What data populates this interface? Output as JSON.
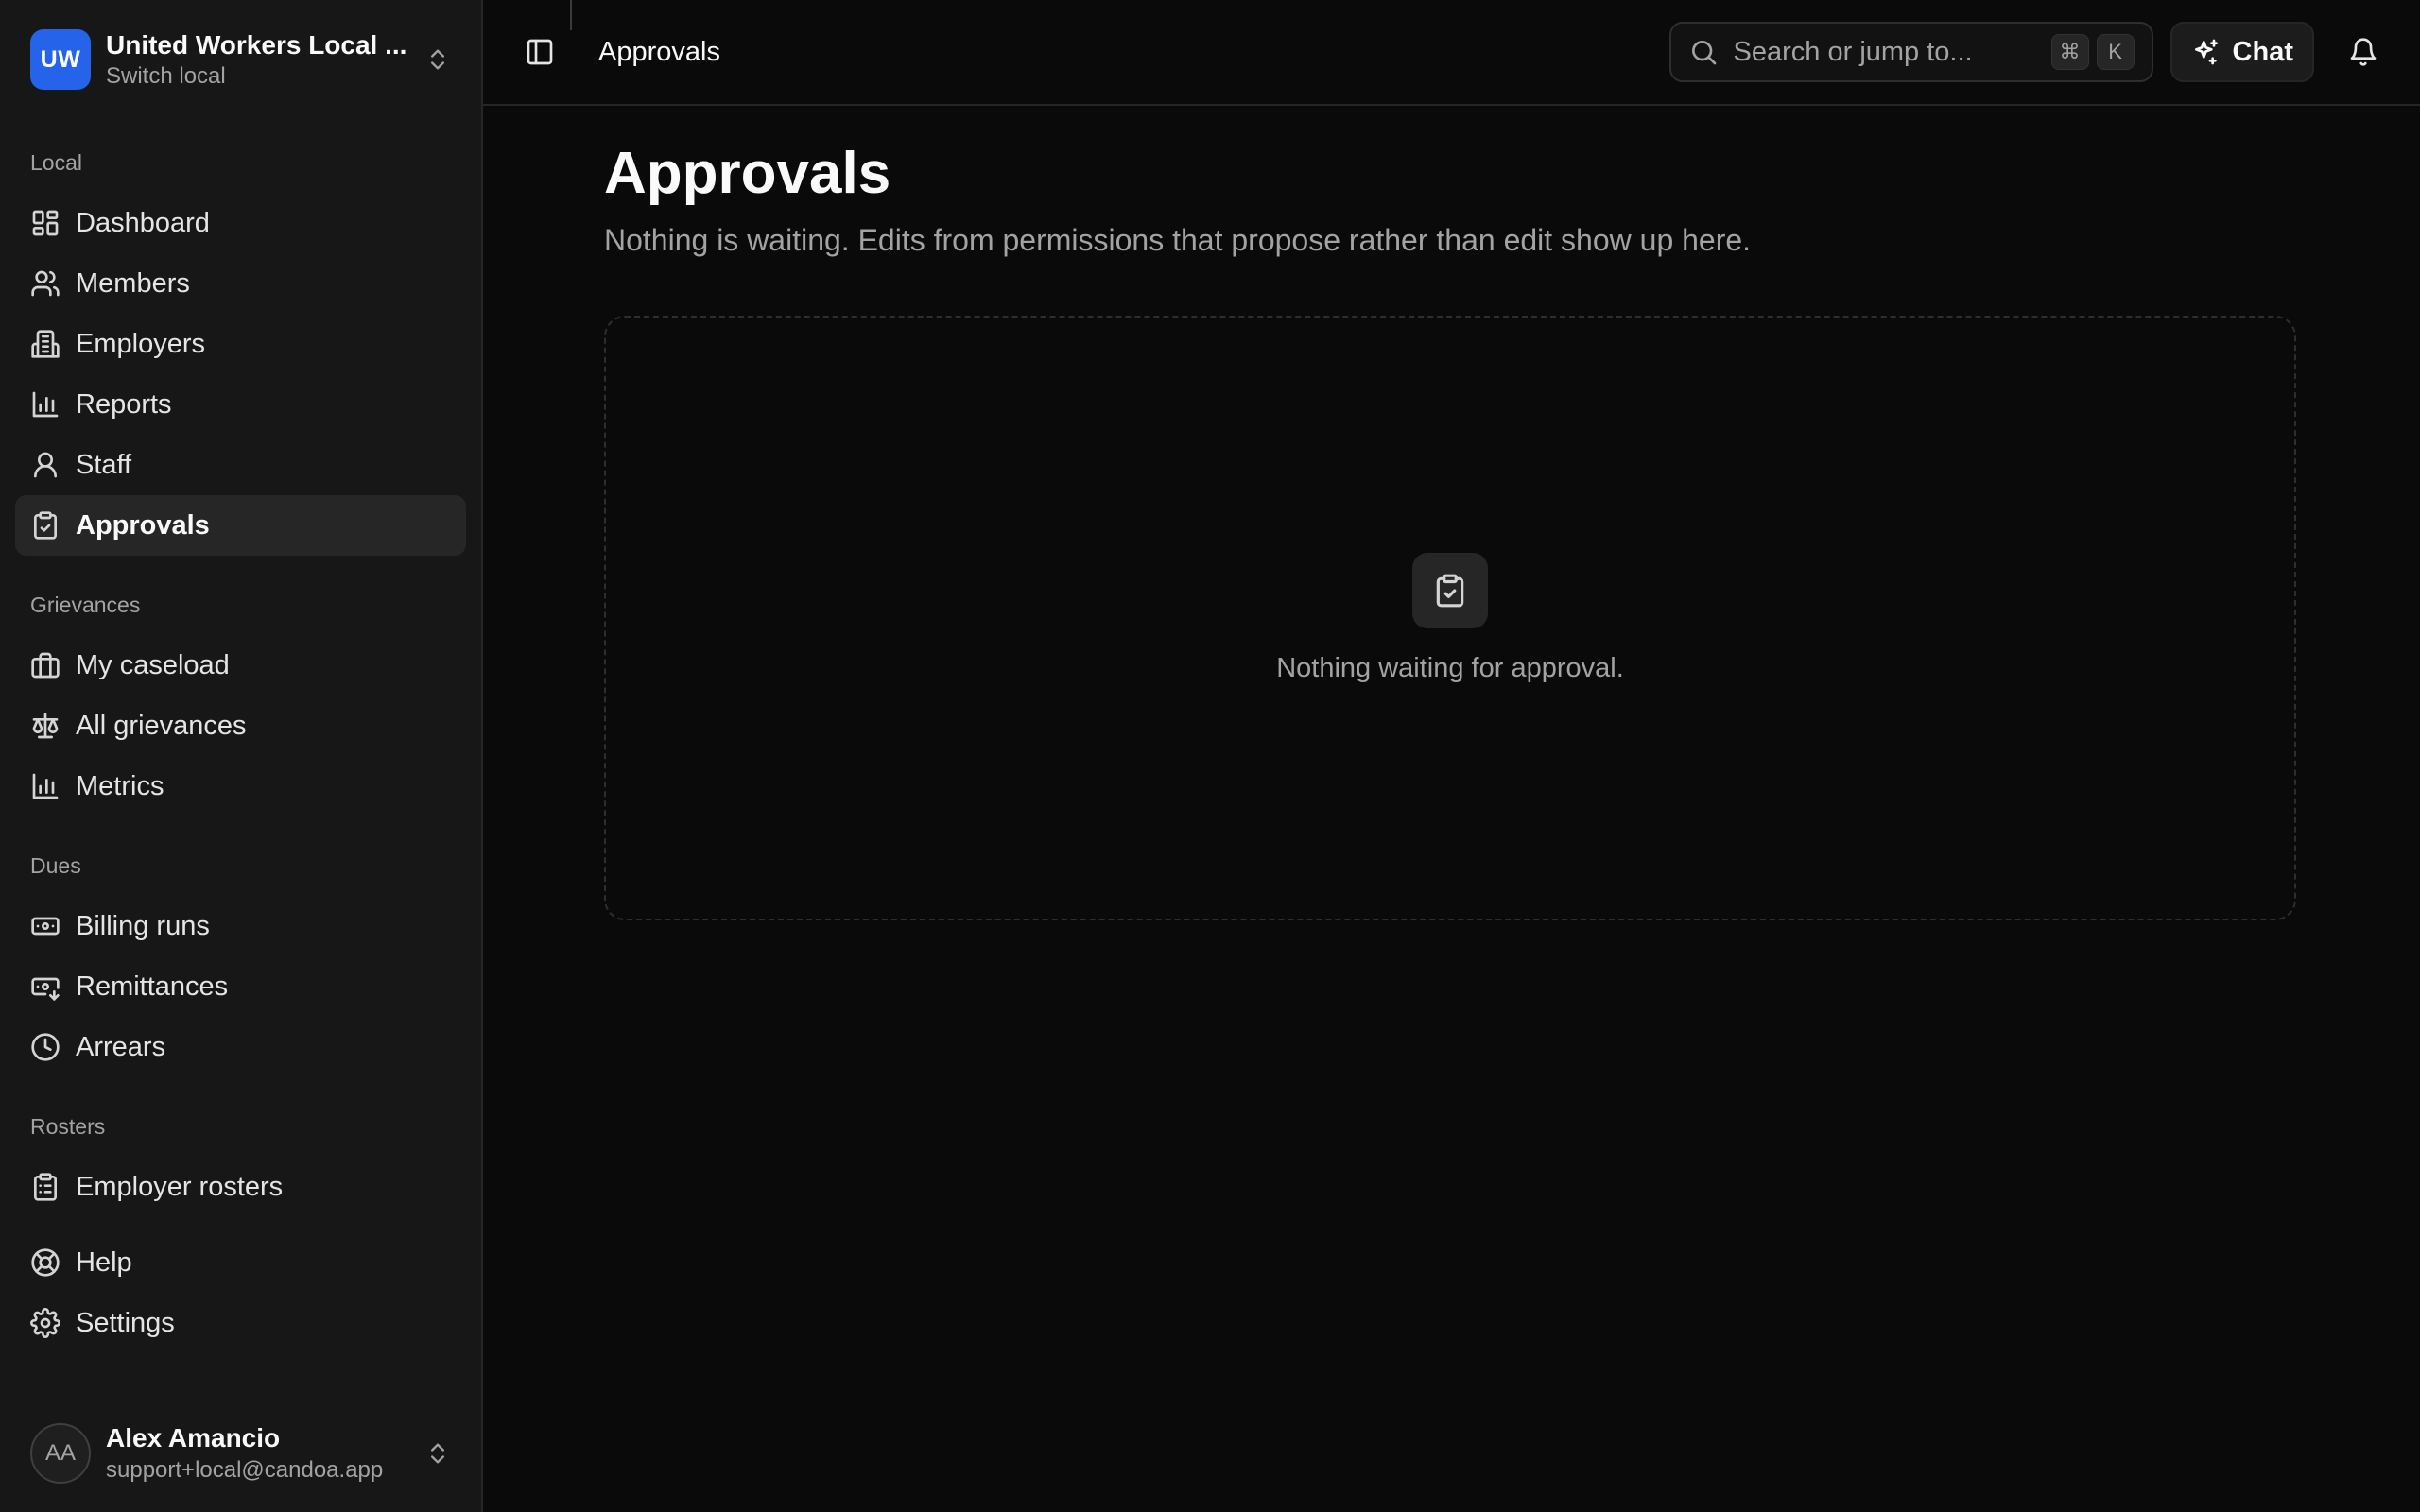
{
  "org": {
    "initials": "UW",
    "name": "United Workers Local ...",
    "switch_label": "Switch local"
  },
  "sidebar": {
    "sections": [
      {
        "label": "Local",
        "items": [
          {
            "label": "Dashboard",
            "icon": "dashboard-icon"
          },
          {
            "label": "Members",
            "icon": "users-icon"
          },
          {
            "label": "Employers",
            "icon": "building-icon"
          },
          {
            "label": "Reports",
            "icon": "bar-chart-icon"
          },
          {
            "label": "Staff",
            "icon": "user-icon"
          },
          {
            "label": "Approvals",
            "icon": "clipboard-check-icon",
            "active": true
          }
        ]
      },
      {
        "label": "Grievances",
        "items": [
          {
            "label": "My caseload",
            "icon": "briefcase-icon"
          },
          {
            "label": "All grievances",
            "icon": "scale-icon"
          },
          {
            "label": "Metrics",
            "icon": "bar-chart-icon"
          }
        ]
      },
      {
        "label": "Dues",
        "items": [
          {
            "label": "Billing runs",
            "icon": "banknote-icon"
          },
          {
            "label": "Remittances",
            "icon": "banknote-arrow-icon"
          },
          {
            "label": "Arrears",
            "icon": "clock-icon"
          }
        ]
      },
      {
        "label": "Rosters",
        "items": [
          {
            "label": "Employer rosters",
            "icon": "clipboard-list-icon"
          }
        ]
      }
    ],
    "footer_items": [
      {
        "label": "Help",
        "icon": "lifebuoy-icon"
      },
      {
        "label": "Settings",
        "icon": "gear-icon"
      }
    ]
  },
  "user": {
    "initials": "AA",
    "name": "Alex Amancio",
    "email": "support+local@candoa.app"
  },
  "topbar": {
    "breadcrumb": "Approvals",
    "search_placeholder": "Search or jump to...",
    "shortcut_mod": "⌘",
    "shortcut_key": "K",
    "chat_label": "Chat"
  },
  "page": {
    "title": "Approvals",
    "subtitle": "Nothing is waiting. Edits from permissions that propose rather than edit show up here.",
    "empty_text": "Nothing waiting for approval."
  },
  "colors": {
    "accent": "#2563eb",
    "background": "#0a0a0a",
    "sidebar": "#171717"
  }
}
